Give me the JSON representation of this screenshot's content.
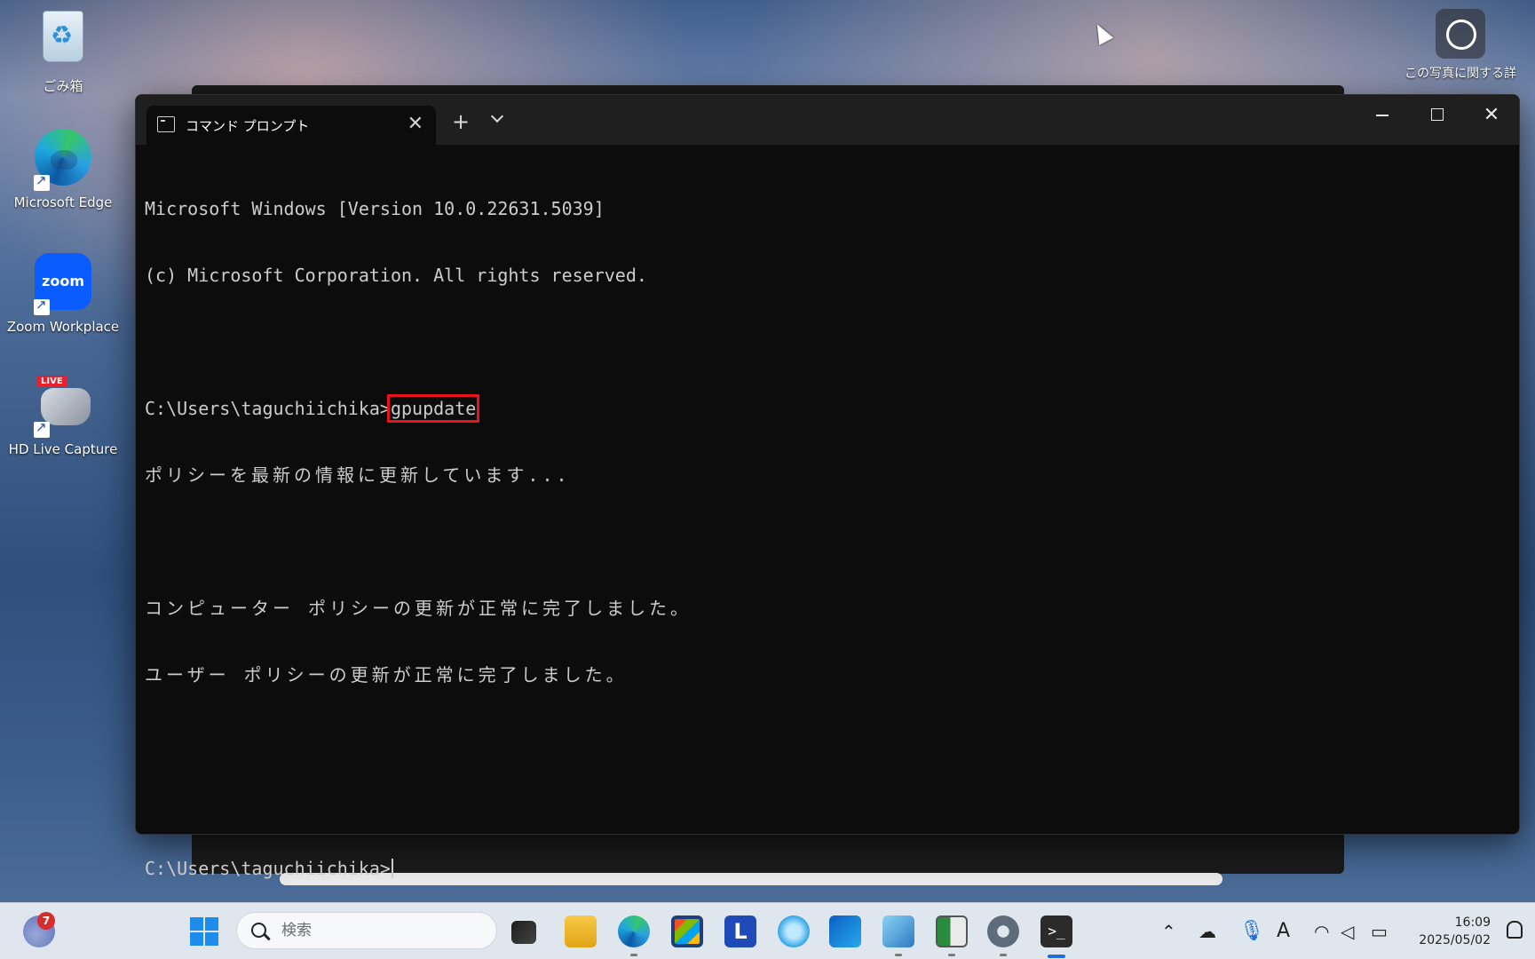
{
  "desktop": {
    "icons": [
      {
        "label": "ごみ箱",
        "icon": "recycle-bin-icon"
      },
      {
        "label": "Microsoft Edge",
        "icon": "edge-icon"
      },
      {
        "label": "Zoom Workplace",
        "icon": "zoom-icon",
        "logo_text": "zoom"
      },
      {
        "label": "HD Live Capture",
        "icon": "capture-icon",
        "badge": "LIVE"
      }
    ],
    "photo_info": "この写真に関する詳"
  },
  "window": {
    "tab_title": "コマンド プロンプト",
    "console": {
      "line1": "Microsoft Windows [Version 10.0.22631.5039]",
      "line2": "(c) Microsoft Corporation. All rights reserved.",
      "prompt": "C:\\Users\\taguchiichika>",
      "command": "gpupdate",
      "status": "ポリシーを最新の情報に更新しています...",
      "computer_policy": "コンピューター ポリシーの更新が正常に完了しました。",
      "user_policy": "ユーザー ポリシーの更新が正常に完了しました。"
    },
    "highlight_color": "#e8141c"
  },
  "taskbar": {
    "weather_badge": "7",
    "search_placeholder": "検索",
    "apps": [
      "file-manager-icon",
      "explorer-folder-icon",
      "edge-icon",
      "store-icon",
      "l-app-icon",
      "browser-icon",
      "outlook-icon",
      "control-panel-icon",
      "task-app-icon",
      "settings-icon",
      "terminal-icon"
    ],
    "clock_time": "16:09",
    "clock_date": "2025/05/02"
  }
}
